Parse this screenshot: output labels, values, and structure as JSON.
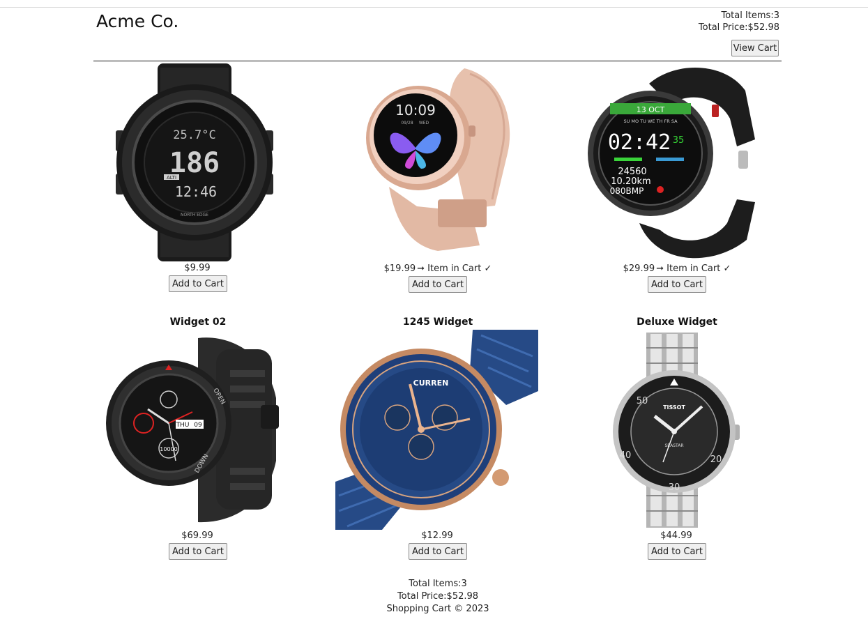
{
  "header": {
    "brand": "Acme Co.",
    "total_items_label": "Total Items:",
    "total_items": "3",
    "total_price_label": "Total Price:",
    "total_price": "$52.98",
    "view_cart_label": "View Cart"
  },
  "products": [
    {
      "name": "",
      "price": "$9.99",
      "status": "",
      "add_label": "Add to Cart",
      "icon": "black-outdoor-watch"
    },
    {
      "name": "",
      "price": "$19.99",
      "status": "➞ Item in Cart ✓",
      "add_label": "Add to Cart",
      "icon": "rose-gold-smartwatch"
    },
    {
      "name": "",
      "price": "$29.99",
      "status": "➞ Item in Cart ✓",
      "add_label": "Add to Cart",
      "icon": "black-sport-smartwatch"
    },
    {
      "name": "Widget 02",
      "price": "$69.99",
      "status": "",
      "add_label": "Add to Cart",
      "icon": "rugged-smartwatch"
    },
    {
      "name": "1245 Widget",
      "price": "$12.99",
      "status": "",
      "add_label": "Add to Cart",
      "icon": "blue-chronograph-watch"
    },
    {
      "name": "Deluxe Widget",
      "price": "$44.99",
      "status": "",
      "add_label": "Add to Cart",
      "icon": "steel-dive-watch"
    }
  ],
  "watch_faces": {
    "p0": {
      "temp": "25.7°C",
      "altitude": "186",
      "time": "12:46",
      "alti": "ALTI",
      "brand": "NORTH EDGE"
    },
    "p1": {
      "time": "10:09",
      "date": "09/28",
      "day": "WED"
    },
    "p2": {
      "date": "13 OCT",
      "days": "SU MO TU WE TH FR SA",
      "time": "02:42",
      "seconds": "35",
      "steps": "24560",
      "distance": "10.20km",
      "heart": "080BMP"
    },
    "p3": {
      "day": "THU",
      "date": "09",
      "steps": "10000",
      "open": "OPEN",
      "down": "DOWN"
    },
    "p4": {
      "brand": "CURREN"
    },
    "p5": {
      "brand": "TISSOT",
      "model": "SEASTAR",
      "bezel_50": "50",
      "bezel_40": "40",
      "bezel_30": "30",
      "bezel_20": "20"
    }
  },
  "footer": {
    "total_items_label": "Total Items:",
    "total_items": "3",
    "total_price_label": "Total Price:",
    "total_price": "$52.98",
    "copyright": "Shopping Cart © 2023"
  }
}
